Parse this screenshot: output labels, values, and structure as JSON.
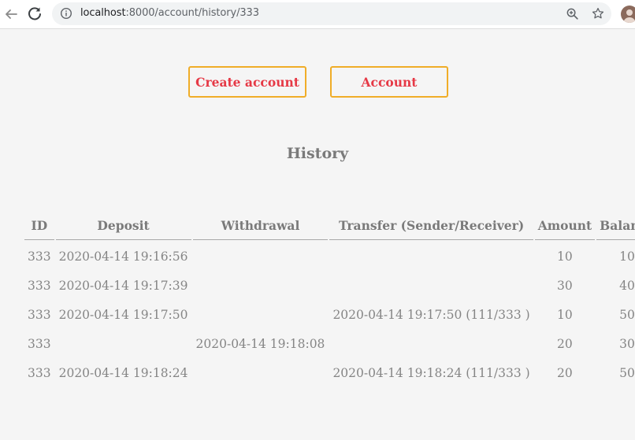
{
  "browser": {
    "url_host": "localhost",
    "url_path": ":8000/account/history/333",
    "icons": {
      "back": "arrow-left-icon",
      "reload": "reload-icon",
      "info": "info-icon",
      "zoom": "zoom-in-icon",
      "bookmark": "star-icon",
      "profile": "avatar"
    }
  },
  "nav": {
    "create_account": "Create account",
    "account": "Account"
  },
  "page": {
    "title": "History"
  },
  "table": {
    "headers": [
      "ID",
      "Deposit",
      "Withdrawal",
      "Transfer (Sender/Receiver)",
      "Amount",
      "Balance"
    ],
    "rows": [
      {
        "id": "333",
        "deposit": "2020-04-14 19:16:56",
        "withdrawal": "",
        "transfer": "",
        "amount": "10",
        "balance": "10"
      },
      {
        "id": "333",
        "deposit": "2020-04-14 19:17:39",
        "withdrawal": "",
        "transfer": "",
        "amount": "30",
        "balance": "40"
      },
      {
        "id": "333",
        "deposit": "2020-04-14 19:17:50",
        "withdrawal": "",
        "transfer": "2020-04-14 19:17:50 (111/333 )",
        "amount": "10",
        "balance": "50"
      },
      {
        "id": "333",
        "deposit": "",
        "withdrawal": "2020-04-14 19:18:08",
        "transfer": "",
        "amount": "20",
        "balance": "30"
      },
      {
        "id": "333",
        "deposit": "2020-04-14 19:18:24",
        "withdrawal": "",
        "transfer": "2020-04-14 19:18:24 (111/333 )",
        "amount": "20",
        "balance": "50"
      }
    ]
  },
  "colors": {
    "button_border": "#f0ad28",
    "button_text": "#e63946",
    "text": "#858585",
    "background": "#f5f5f5"
  }
}
